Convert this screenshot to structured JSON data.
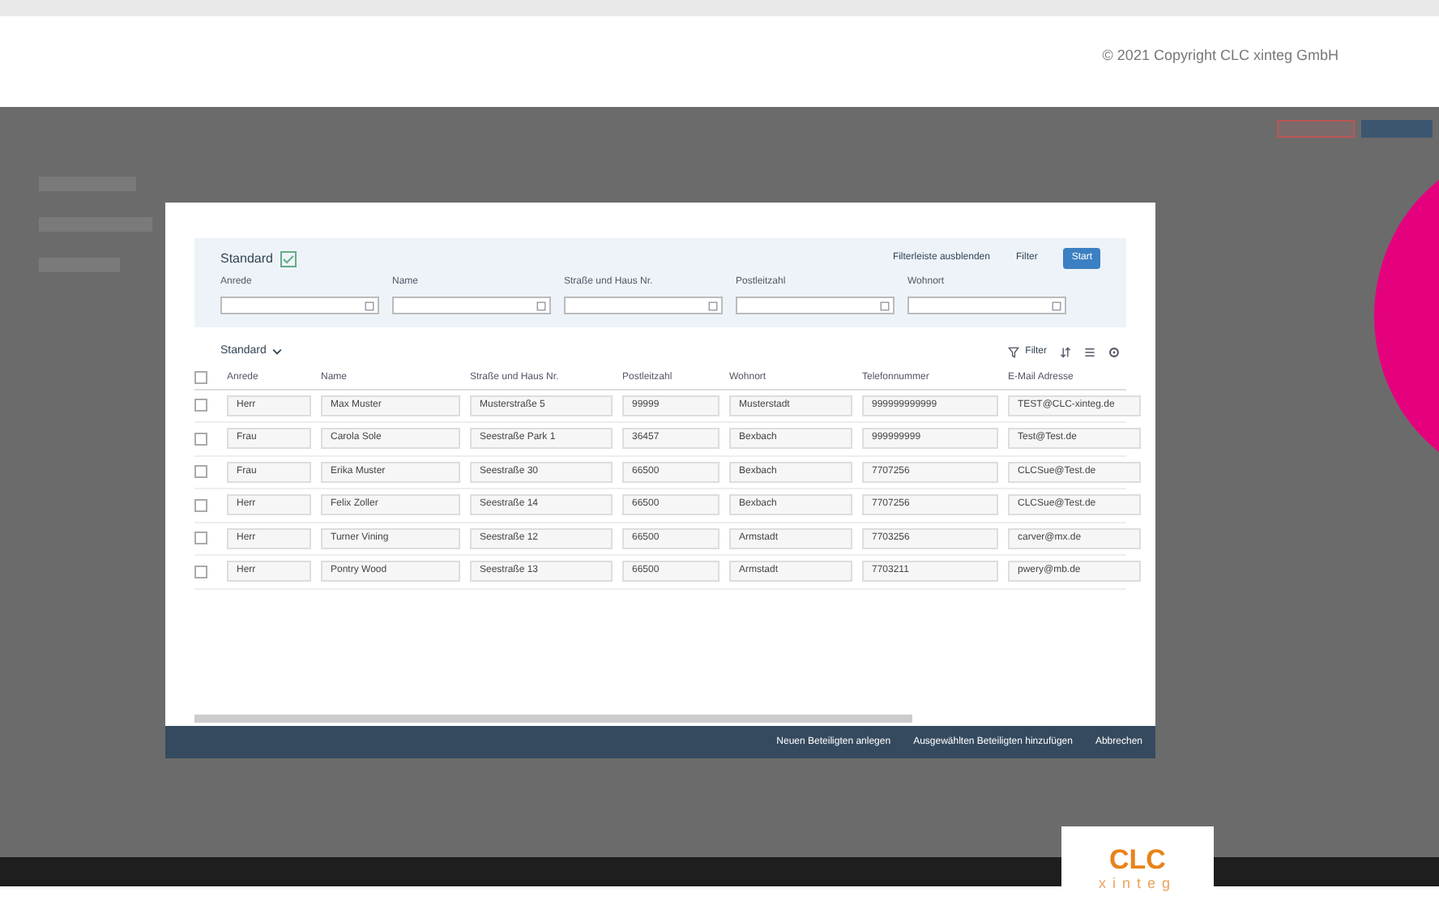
{
  "copyright": "© 2021 Copyright CLC xinteg GmbH",
  "dialog": {
    "filter_bar": {
      "variant": "Standard",
      "hide_label": "Filterleiste ausblenden",
      "filter_label": "Filter",
      "go_label": "Start",
      "fields": [
        {
          "label": "Anrede"
        },
        {
          "label": "Name"
        },
        {
          "label": "Straße und Haus Nr."
        },
        {
          "label": "Postleitzahl"
        },
        {
          "label": "Wohnort"
        }
      ]
    },
    "table": {
      "variant": "Standard",
      "filter_label": "Filter",
      "all_selected": false,
      "columns": [
        "Anrede",
        "Name",
        "Straße und Haus Nr.",
        "Postleitzahl",
        "Wohnort",
        "Telefonnummer",
        "E-Mail Adresse"
      ],
      "rows": [
        {
          "selected": false,
          "cells": [
            "Herr",
            "Max Muster",
            "Musterstraße 5",
            "99999",
            "Musterstadt",
            "999999999999",
            "TEST@CLC-xinteg.de"
          ]
        },
        {
          "selected": false,
          "cells": [
            "Frau",
            "Carola Sole",
            "Seestraße Park 1",
            "36457",
            "Bexbach",
            "999999999",
            "Test@Test.de"
          ]
        },
        {
          "selected": false,
          "cells": [
            "Frau",
            "Erika Muster",
            "Seestraße 30",
            "66500",
            "Bexbach",
            "7707256",
            "CLCSue@Test.de"
          ]
        },
        {
          "selected": false,
          "cells": [
            "Herr",
            "Felix Zoller",
            "Seestraße 14",
            "66500",
            "Bexbach",
            "7707256",
            "CLCSue@Test.de"
          ]
        },
        {
          "selected": false,
          "cells": [
            "Herr",
            "Turner Vining",
            "Seestraße 12",
            "66500",
            "Armstadt",
            "7703256",
            "carver@mx.de"
          ]
        },
        {
          "selected": false,
          "cells": [
            "Herr",
            "Pontry Wood",
            "Seestraße 13",
            "66500",
            "Armstadt",
            "7703211",
            "pwery@mb.de"
          ]
        }
      ]
    },
    "footer_buttons": [
      "Neuen Beteiligten anlegen",
      "Ausgewählten Beteiligten hinzufügen",
      "Abbrechen"
    ]
  },
  "logo": {
    "text": "CLC",
    "subtext": "xinteg"
  }
}
